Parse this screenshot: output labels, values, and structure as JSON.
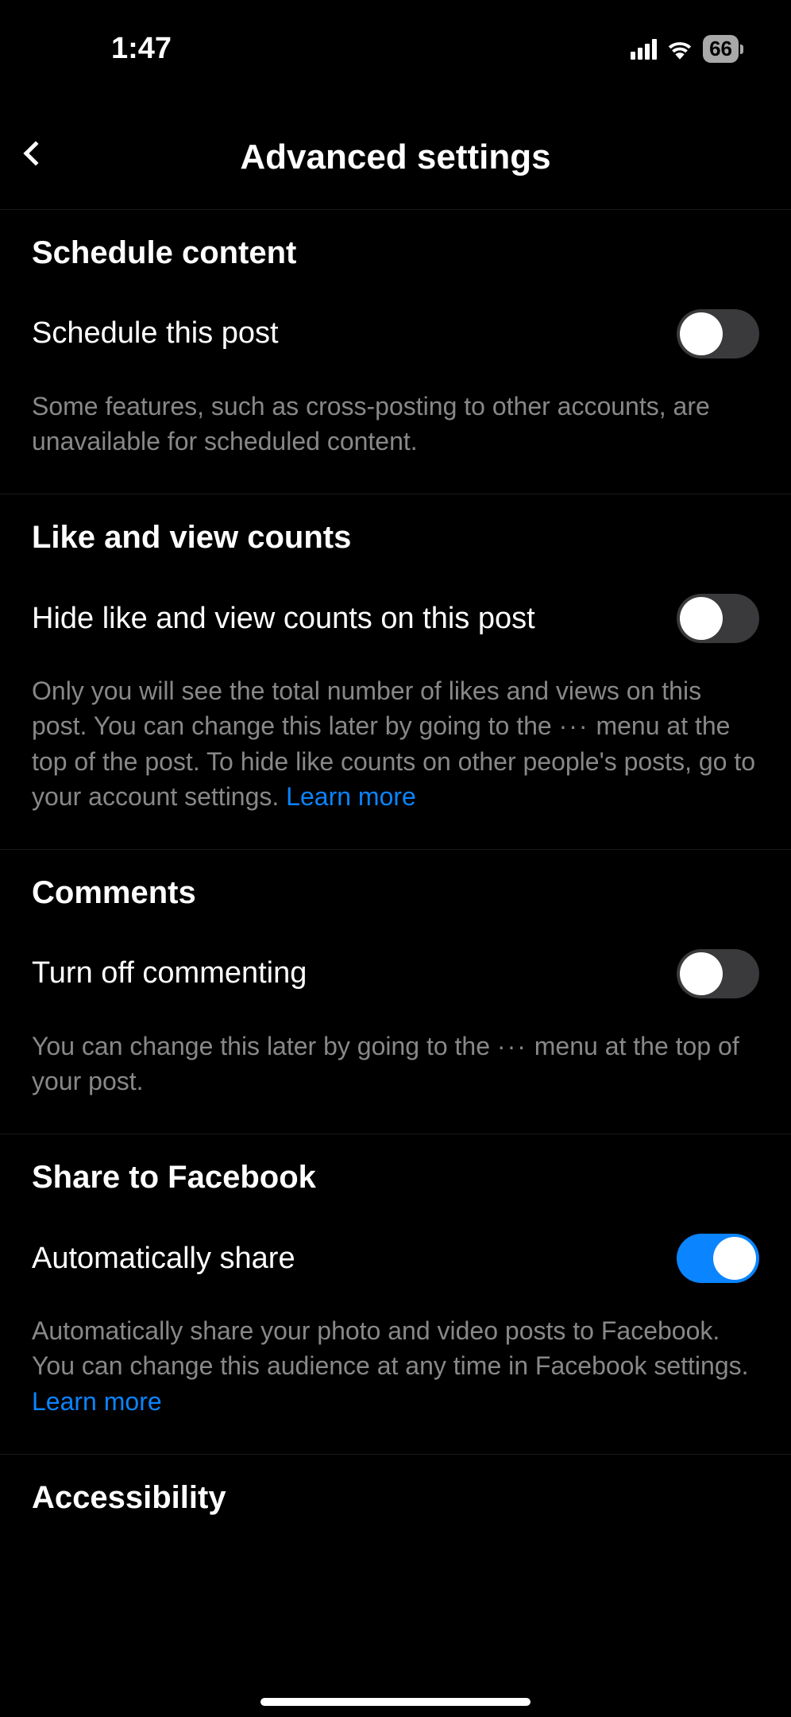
{
  "status": {
    "time": "1:47",
    "battery": "66"
  },
  "header": {
    "title": "Advanced settings"
  },
  "sections": {
    "schedule": {
      "title": "Schedule content",
      "row_label": "Schedule this post",
      "toggle_on": false,
      "helper": "Some features, such as cross-posting to other accounts, are unavailable for scheduled content."
    },
    "likes": {
      "title": "Like and view counts",
      "row_label": "Hide like and view counts on this post",
      "toggle_on": false,
      "helper_pre": "Only you will see the total number of likes and views on this post. You can change this later by going to the ",
      "dots": "···",
      "helper_post": " menu at the top of the post. To hide like counts on other people's posts, go to your account settings. ",
      "link": "Learn more"
    },
    "comments": {
      "title": "Comments",
      "row_label": "Turn off commenting",
      "toggle_on": false,
      "helper_pre": "You can change this later by going to the ",
      "dots": "···",
      "helper_post": " menu at the top of your post."
    },
    "facebook": {
      "title": "Share to Facebook",
      "row_label": "Automatically share",
      "toggle_on": true,
      "helper": "Automatically share your photo and video posts to Facebook. You can change this audience at any time in Facebook settings. ",
      "link": "Learn more"
    },
    "accessibility": {
      "title": "Accessibility"
    }
  }
}
